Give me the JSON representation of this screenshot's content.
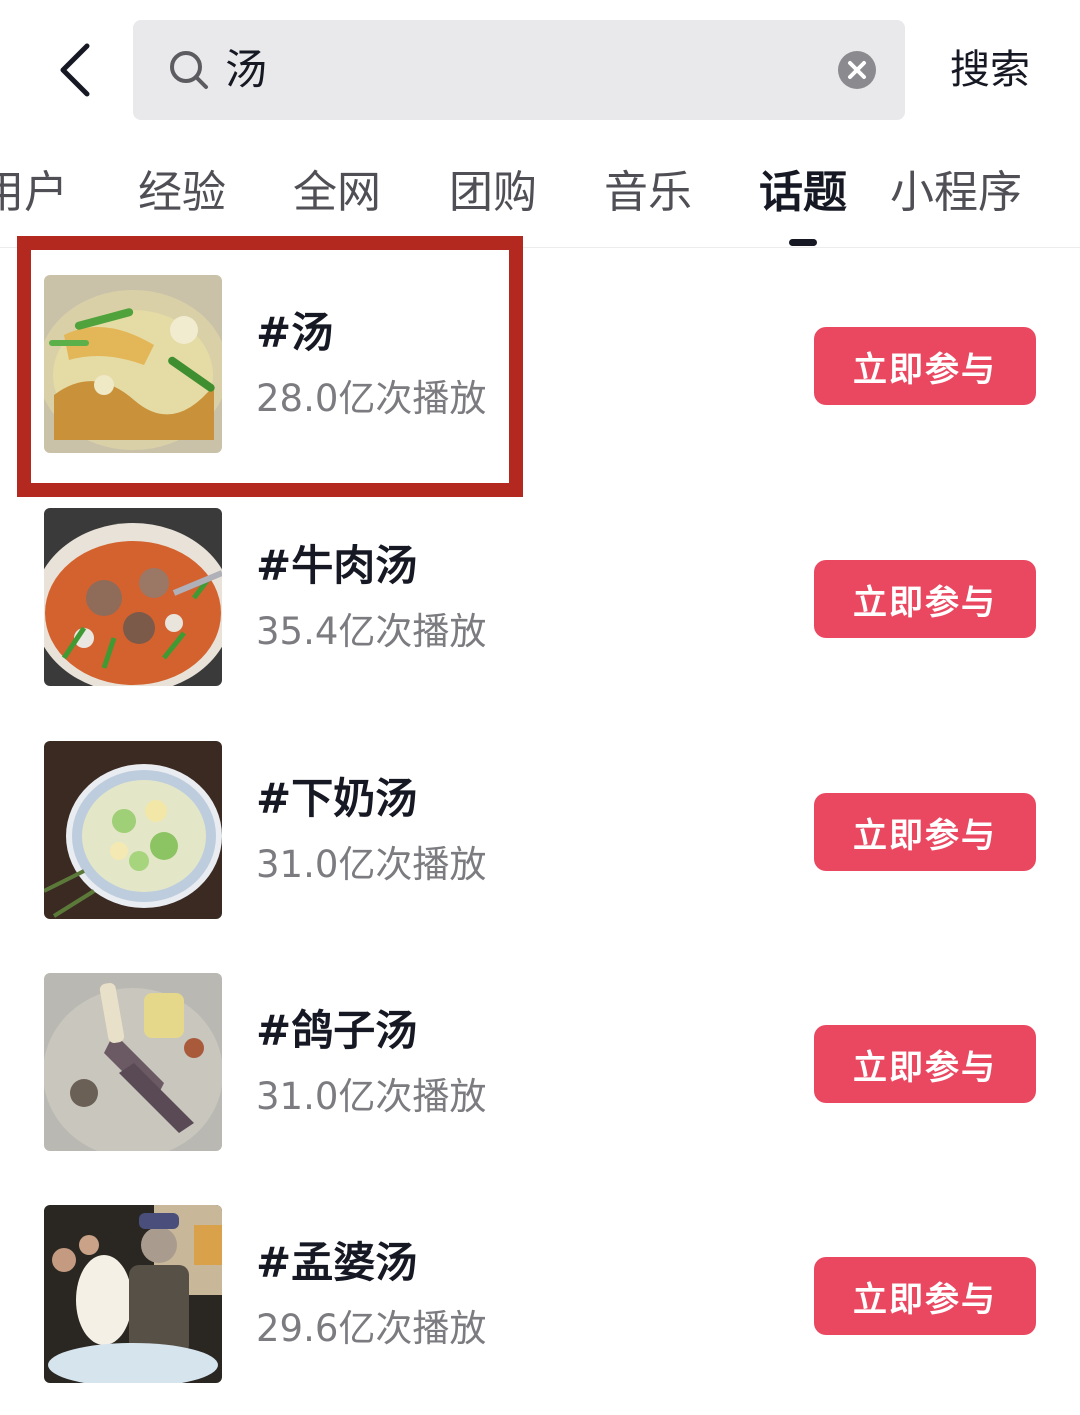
{
  "search": {
    "query": "汤",
    "submit_label": "搜索"
  },
  "tabs": [
    {
      "label": "用户"
    },
    {
      "label": "经验"
    },
    {
      "label": "全网"
    },
    {
      "label": "团购"
    },
    {
      "label": "音乐"
    },
    {
      "label": "话题",
      "active": true
    },
    {
      "label": "小程序"
    }
  ],
  "topics": [
    {
      "title": "#汤",
      "plays": "28.0亿次播放",
      "button": "立即参与",
      "highlighted": true
    },
    {
      "title": "#牛肉汤",
      "plays": "35.4亿次播放",
      "button": "立即参与"
    },
    {
      "title": "#下奶汤",
      "plays": "31.0亿次播放",
      "button": "立即参与"
    },
    {
      "title": "#鸽子汤",
      "plays": "31.0亿次播放",
      "button": "立即参与"
    },
    {
      "title": "#孟婆汤",
      "plays": "29.6亿次播放",
      "button": "立即参与"
    }
  ],
  "colors": {
    "accent": "#ea4861",
    "highlight_border": "#b3281f",
    "search_bg": "#e9e9eb"
  },
  "icons": [
    "back-arrow-icon",
    "search-icon",
    "clear-icon"
  ]
}
